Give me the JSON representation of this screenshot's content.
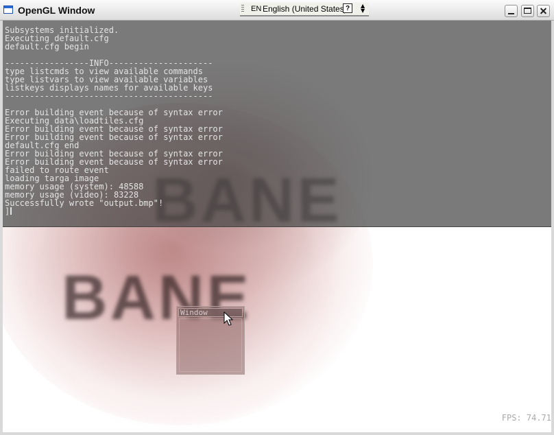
{
  "window": {
    "title": "OpenGL Window",
    "buttons": {
      "minimize": "minimize",
      "maximize": "maximize",
      "close": "close"
    }
  },
  "language_bar": {
    "code": "EN",
    "name": "English (United States)",
    "help_glyph": "?",
    "arrows": "▲▼"
  },
  "console": {
    "lines": [
      "Subsystems initialized.",
      "Executing default.cfg",
      "default.cfg begin",
      "",
      "-----------------INFO---------------------",
      "type listcmds to view available commands",
      "type listvars to view available variables",
      "listkeys displays names for available keys",
      "------------------------------------------",
      "",
      "Error building event because of syntax error",
      "Executing data\\loadtiles.cfg",
      "Error building event because of syntax error",
      "Error building event because of syntax error",
      "default.cfg end",
      "Error building event because of syntax error",
      "Error building event because of syntax error",
      "failed to route event",
      "loading targa image",
      "memory usage (system): 48588",
      "memory usage (video): 83228",
      "Successfully wrote \"output.bmp\"!"
    ],
    "prompt": "]"
  },
  "scene": {
    "logo_text": "BANE"
  },
  "gui_window": {
    "title": "Window"
  },
  "fps": {
    "text": "FPS: 74.71"
  },
  "colors": {
    "console_bg": "#4a4a4a",
    "console_text": "#e4e4e4",
    "blob": "#aa6464",
    "fps_text": "#a9a9a9"
  }
}
